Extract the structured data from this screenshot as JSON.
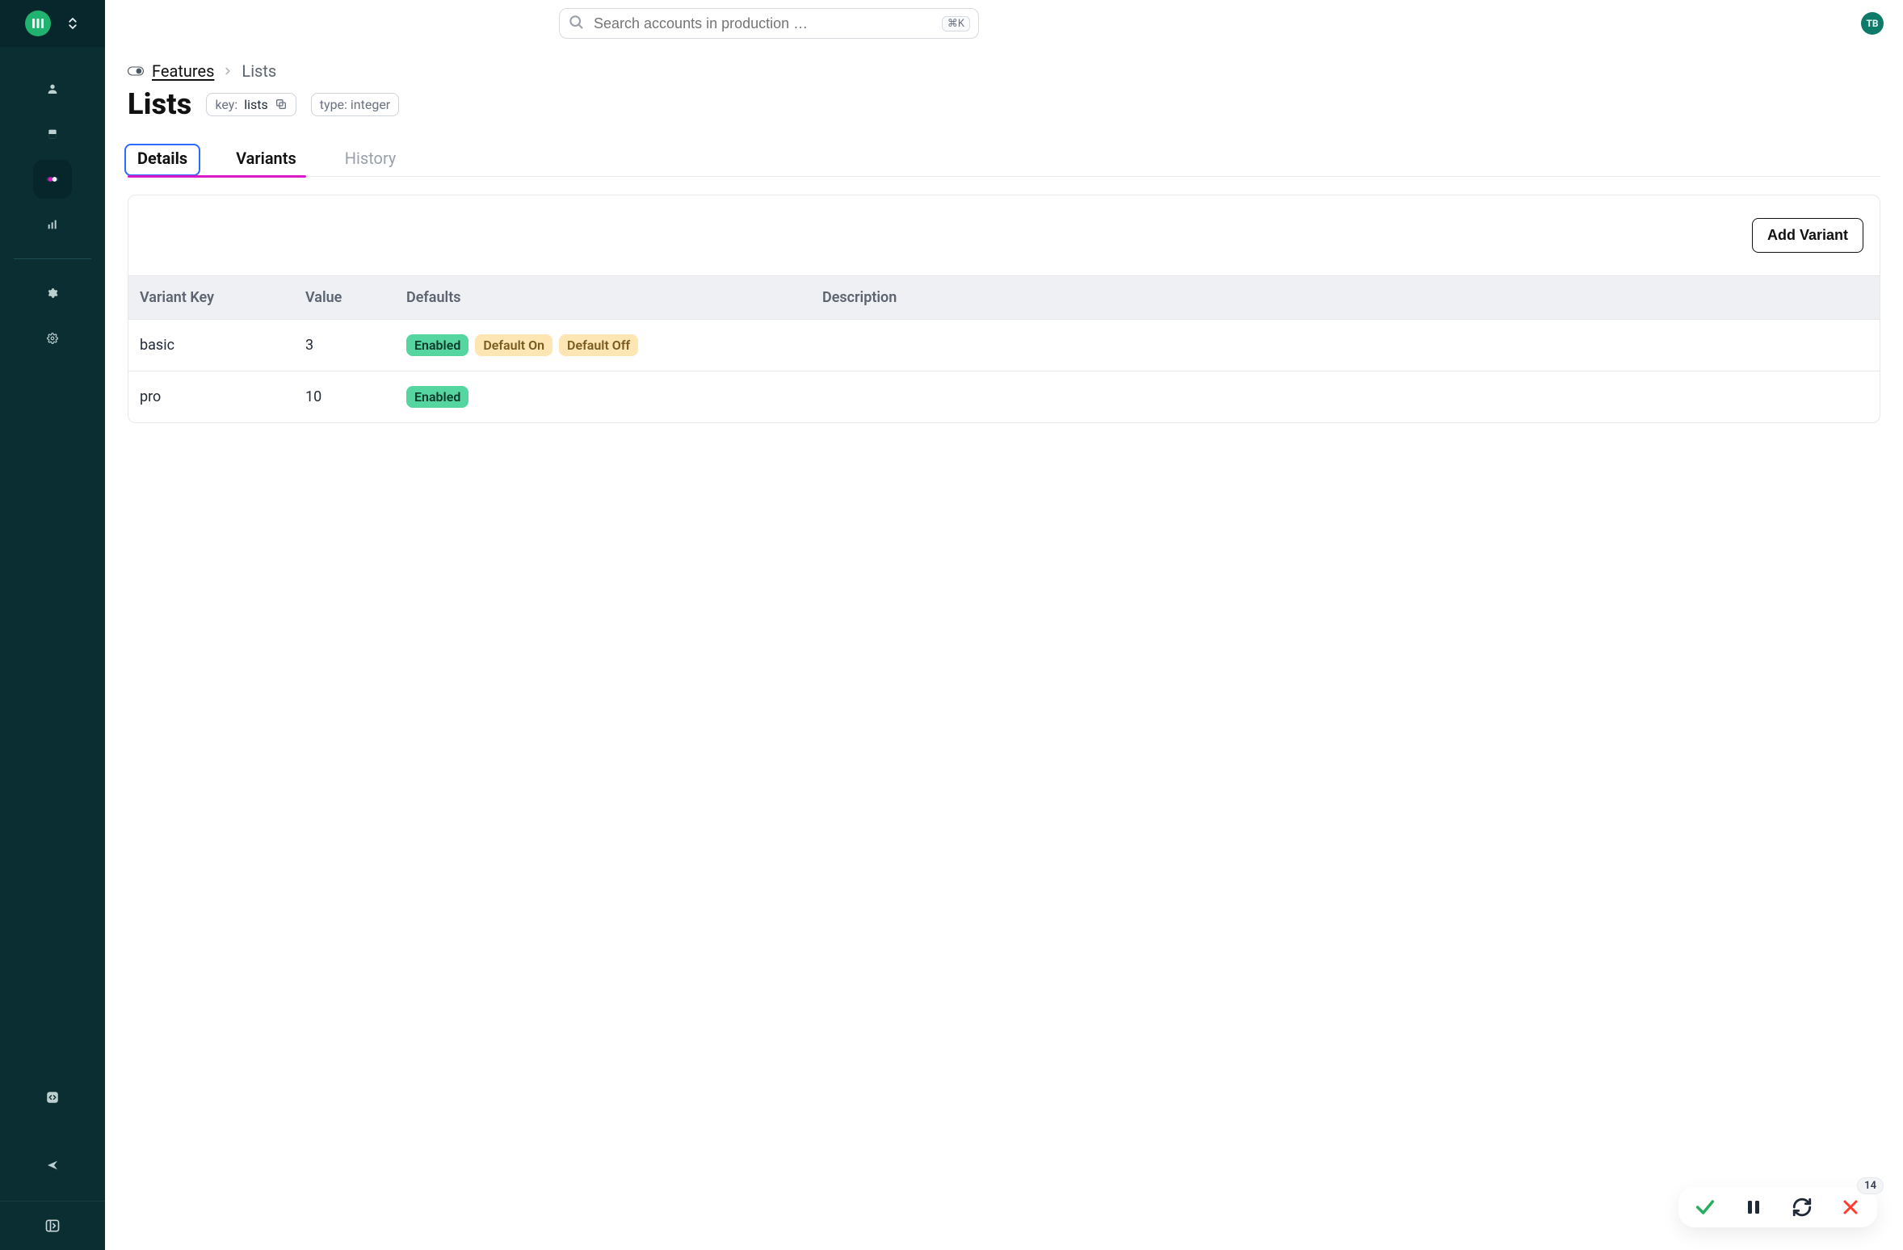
{
  "header": {
    "search_placeholder": "Search accounts in production …",
    "shortcut": "⌘K",
    "avatar_initials": "TB"
  },
  "breadcrumb": {
    "root": "Features",
    "current": "Lists"
  },
  "page": {
    "title": "Lists",
    "key_label": "key:",
    "key_value": "lists",
    "type_text": "type: integer"
  },
  "tabs": {
    "items": [
      "Details",
      "Variants",
      "History"
    ],
    "focused_index": 0,
    "underline_index": 1
  },
  "panel": {
    "add_button": "Add Variant",
    "columns": {
      "key": "Variant Key",
      "value": "Value",
      "defaults": "Defaults",
      "description": "Description"
    },
    "rows": [
      {
        "key": "basic",
        "value": "3",
        "tags": [
          {
            "text": "Enabled",
            "kind": "enabled"
          },
          {
            "text": "Default On",
            "kind": "warn"
          },
          {
            "text": "Default Off",
            "kind": "warn"
          }
        ],
        "description": ""
      },
      {
        "key": "pro",
        "value": "10",
        "tags": [
          {
            "text": "Enabled",
            "kind": "enabled"
          }
        ],
        "description": ""
      }
    ]
  },
  "fab": {
    "count": "14"
  },
  "sidebar": {
    "items": [
      {
        "name": "user-icon"
      },
      {
        "name": "database-icon"
      },
      {
        "name": "toggle-dots-icon",
        "active": true
      },
      {
        "name": "bar-chart-icon"
      },
      {
        "name": "gear-icon"
      },
      {
        "name": "gear-outline-icon"
      }
    ],
    "bottom_items": [
      {
        "name": "code-icon"
      },
      {
        "name": "send-icon"
      }
    ]
  }
}
